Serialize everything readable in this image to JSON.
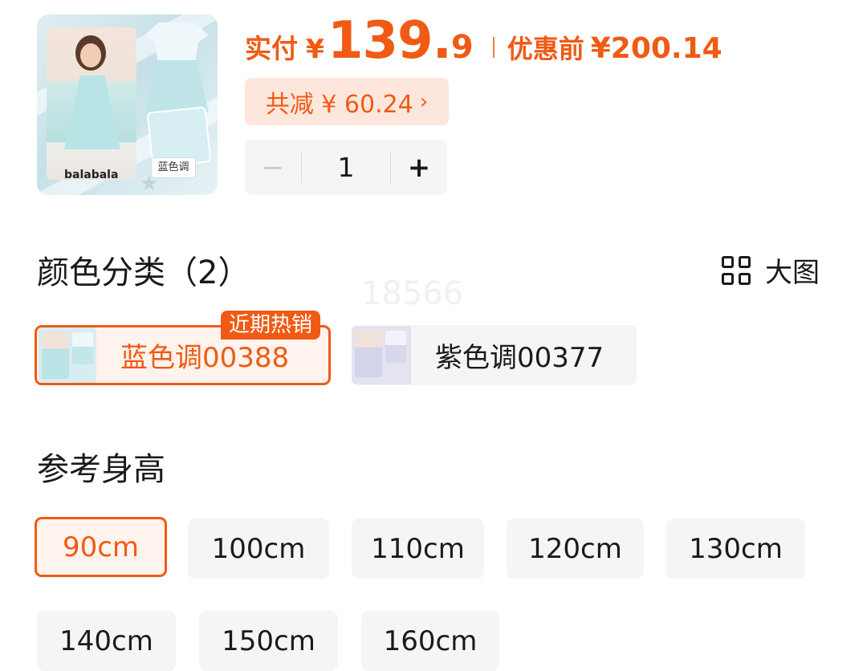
{
  "product": {
    "image_brand": "balabala",
    "image_tag": "蓝色调"
  },
  "price": {
    "pay_label": "实付",
    "currency": "¥",
    "integer": "139.",
    "decimal": "9",
    "original_label": "优惠前",
    "original_price": "¥200.14"
  },
  "discount": {
    "label": "共减 ¥ 60.24",
    "chevron": "›"
  },
  "quantity": {
    "minus": "−",
    "value": "1",
    "plus": "+"
  },
  "color_section": {
    "title": "颜色分类（2）",
    "big_image_label": "大图",
    "watermark": "18566",
    "options": [
      {
        "label": "蓝色调00388",
        "selected": true,
        "badge": "近期热销"
      },
      {
        "label": "紫色调00377",
        "selected": false
      }
    ]
  },
  "height_section": {
    "title": "参考身高",
    "sizes": [
      "90cm",
      "100cm",
      "110cm",
      "120cm",
      "130cm",
      "140cm",
      "150cm",
      "160cm"
    ],
    "selected": "90cm"
  },
  "colors": {
    "accent": "#f05a14",
    "accent_bg": "#fde7dc",
    "option_bg": "#f5f5f5"
  }
}
